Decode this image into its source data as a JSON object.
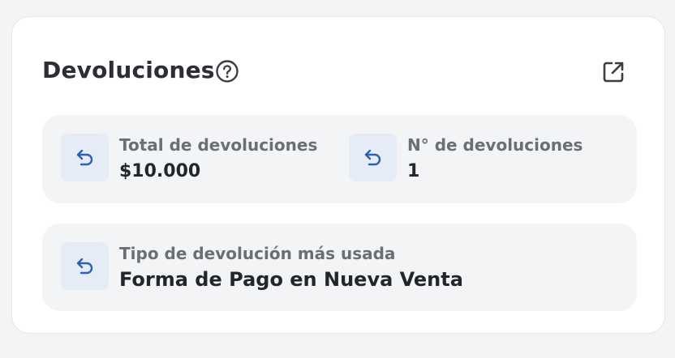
{
  "widget": {
    "title": "Devoluciones",
    "stats": [
      {
        "label": "Total de devoluciones",
        "value": "$10.000"
      },
      {
        "label": "N° de devoluciones",
        "value": "1"
      }
    ],
    "most_used": {
      "label": "Tipo de devolución más usada",
      "value": "Forma de Pago en Nueva Venta"
    }
  },
  "colors": {
    "accent": "#2f5fb3",
    "icon_bg": "#e6ecf6",
    "panel_bg": "#f3f4f6"
  },
  "icons": [
    "help-circle-icon",
    "external-link-icon",
    "undo-arrow-icon"
  ]
}
